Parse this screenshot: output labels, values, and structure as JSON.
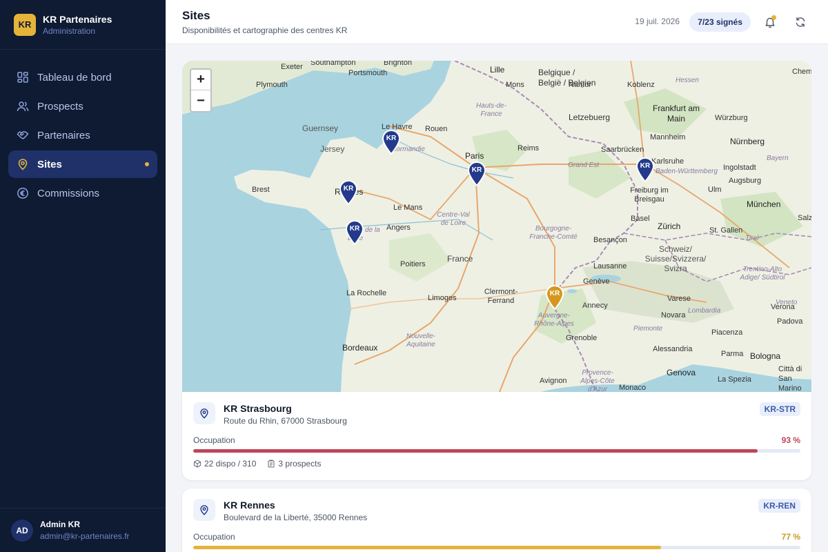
{
  "brand": {
    "logo": "KR",
    "name": "KR Partenaires",
    "subtitle": "Administration"
  },
  "nav": {
    "items": [
      {
        "label": "Tableau de bord",
        "icon": "dashboard-icon",
        "active": false
      },
      {
        "label": "Prospects",
        "icon": "users-icon",
        "active": false
      },
      {
        "label": "Partenaires",
        "icon": "handshake-icon",
        "active": false
      },
      {
        "label": "Sites",
        "icon": "map-pin-icon",
        "active": true
      },
      {
        "label": "Commissions",
        "icon": "euro-icon",
        "active": false
      }
    ]
  },
  "user": {
    "initials": "AD",
    "name": "Admin KR",
    "email": "admin@kr-partenaires.fr"
  },
  "header": {
    "title": "Sites",
    "subtitle": "Disponibilités et cartographie des centres KR",
    "date": "19 juil. 2026",
    "signed": "7/23 signés"
  },
  "map": {
    "zoom_in": "+",
    "zoom_out": "−",
    "marker_label": "KR",
    "labels": [
      "Exeter",
      "Southampton",
      "Brighton",
      "Portsmouth",
      "Plymouth",
      "Lille",
      "Belgique / België / Belgien",
      "Mons",
      "Namur",
      "Koblenz",
      "Hessen",
      "Frankfurt am Main",
      "Guernsey",
      "Jersey",
      "Le Havre",
      "Rouen",
      "Normandie",
      "Hauts-de-France",
      "Letzebuerg",
      "Würzburg",
      "Mannheim",
      "Nürnberg",
      "Paris",
      "Reims",
      "Saarbrücken",
      "Karlsruhe",
      "Bayern",
      "Ingolstadt",
      "Brest",
      "Rennes",
      "Grand Est",
      "Baden-Württemberg",
      "Augsburg",
      "Ulm",
      "Le Mans",
      "Freiburg im Breisgau",
      "München",
      "Angers",
      "Centre-Val de Loire",
      "Pays de la Loire",
      "Basel",
      "Zürich",
      "St. Gallen",
      "Bourgogne-Franche-Comté",
      "Besançon",
      "Tirol",
      "Schweiz/ Suisse/Svizzera/ Svizra",
      "Poitiers",
      "France",
      "Lausanne",
      "Trentino-Alto Adige/ Südtirol",
      "La Rochelle",
      "Limoges",
      "Clermont-Ferrand",
      "Genève",
      "Annecy",
      "Varese",
      "Verona",
      "Auvergne-Rhône-Alpes",
      "Novara",
      "Lombardia",
      "Padova",
      "Piemonte",
      "Piacenza",
      "Nouvelle-Aquitaine",
      "Grenoble",
      "Bordeaux",
      "Alessandria",
      "Parma",
      "Bologna",
      "Città di San Marino",
      "Genova",
      "La Spezia",
      "Avignon",
      "Provence-Alpes-Côte d'Azur",
      "Monaco",
      "Veneto",
      "Chem",
      "Salzb"
    ]
  },
  "sites": [
    {
      "name": "KR Strasbourg",
      "address": "Route du Rhin, 67000 Strasbourg",
      "code": "KR-STR",
      "occupation_label": "Occupation",
      "occupation": "93 %",
      "occupation_fraction": 0.93,
      "color": "#c0455a",
      "dispo": "22 dispo / 310",
      "prospects": "3 prospects"
    },
    {
      "name": "KR Rennes",
      "address": "Boulevard de la Liberté, 35000 Rennes",
      "code": "KR-REN",
      "occupation_label": "Occupation",
      "occupation": "77 %",
      "occupation_fraction": 0.77,
      "color": "#e6b33a"
    }
  ],
  "colors": {
    "sidebar": "#0f1a33",
    "accent": "#e6b33a",
    "active": "#1f3168",
    "marker_blue": "#233a8c",
    "marker_gold": "#d4981e"
  }
}
